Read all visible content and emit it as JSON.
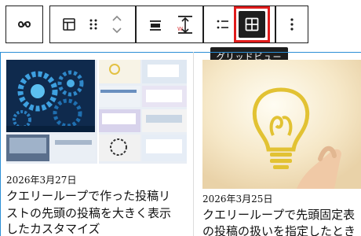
{
  "toolbar": {
    "tooltip": "グリッドビュー",
    "groups": [
      {
        "buttons": [
          "link-icon"
        ]
      },
      {
        "buttons": [
          "block-layout-icon",
          "drag-handle-icon",
          "move-up-down-icon"
        ]
      },
      {
        "buttons": [
          "align-icon",
          "vertical-align-icon"
        ]
      },
      {
        "buttons": [
          "list-view-icon",
          "grid-view-icon"
        ]
      },
      {
        "buttons": [
          "more-options-icon"
        ]
      }
    ],
    "active_button": "grid-view-icon",
    "highlight_color": "#e01c1c"
  },
  "posts": [
    {
      "date": "2026年3月27日",
      "title_lines": [
        "クエリーループで作った投稿リ",
        "ストの先頭の投稿を大きく表示",
        "したカスタマイズ"
      ],
      "image": "collage-thumbnail"
    },
    {
      "date": "2026年3月25日",
      "title_lines": [
        "クエリーループで先頭固定表",
        "の投稿の扱いを指定したとき"
      ],
      "image": "lightbulb-thumbnail"
    }
  ],
  "colors": {
    "selection_outline": "#2b8fd6",
    "toolbar_border": "#1e1e1e",
    "active_fill": "#1e1e1e"
  }
}
